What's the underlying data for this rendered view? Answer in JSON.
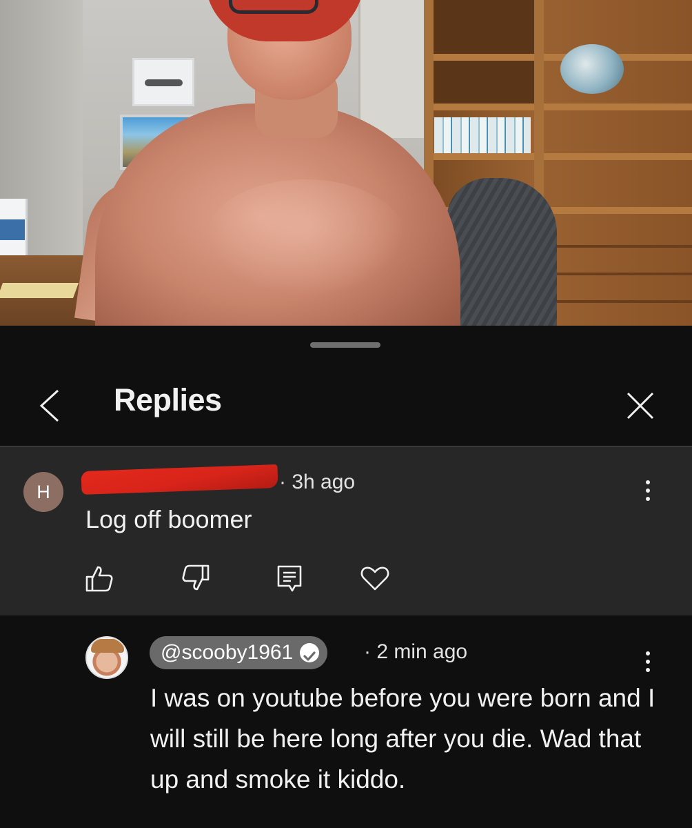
{
  "sheet": {
    "title": "Replies"
  },
  "parent_comment": {
    "avatar_letter": "H",
    "separator_time": "· 3h ago",
    "text": "Log off boomer"
  },
  "reply": {
    "handle": "@scooby1961",
    "separator_time": "· 2 min ago",
    "text": "I was on youtube before you were born and I will still be here long after you die.  Wad that up and smoke it kiddo."
  },
  "icons": {
    "back": "chevron-left-icon",
    "close": "close-icon",
    "more": "more-vertical-icon",
    "like": "thumb-up-icon",
    "dislike": "thumb-down-icon",
    "reply": "comment-icon",
    "heart": "heart-icon",
    "verified": "verified-check-icon"
  },
  "colors": {
    "background": "#0f0f0f",
    "parent_comment_bg": "#272727",
    "handle_chip_bg": "#6a6a6a",
    "avatar_h_bg": "#8d6e63",
    "redaction": "#e3291c"
  }
}
